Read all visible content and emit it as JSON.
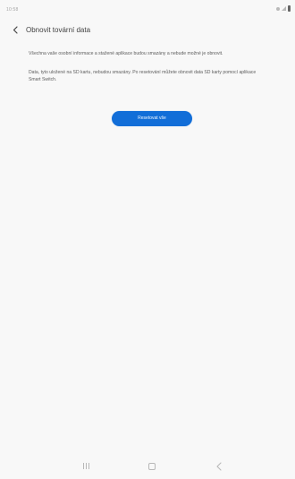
{
  "status_bar": {
    "time": "10:58"
  },
  "header": {
    "title": "Obnovit tovární data"
  },
  "main": {
    "paragraphs": [
      "Všechna vaše osobní informace a stažené aplikace budou smazány a nebude možné je obnovit.",
      "Data, tyto uložené na SD kartu, nebudou smazány. Po resetování můžete obnovit data SD karty pomocí aplikace Smart Switch."
    ],
    "reset_button_label": "Resetovat vše"
  },
  "icons": {
    "back": "back-arrow-icon",
    "recent_apps": "recent-apps-icon",
    "home": "home-icon",
    "navigation_back": "navigation-back-icon"
  },
  "colors": {
    "primary_button": "#126ed8",
    "background": "#f8f8f8"
  }
}
